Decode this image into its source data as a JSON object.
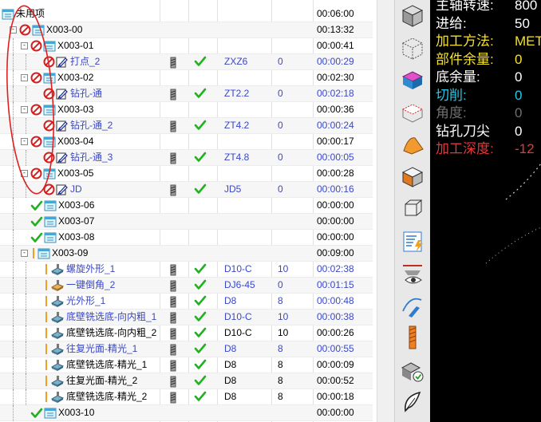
{
  "tree": {
    "rows": [
      {
        "label": "未用项",
        "time": "00:06:00",
        "type": "folder",
        "indent": 0,
        "expander": "",
        "status": "none",
        "blue": false
      },
      {
        "label": "X003-00",
        "time": "00:13:32",
        "type": "folder",
        "indent": 1,
        "expander": "-",
        "status": "forbid",
        "blue": false
      },
      {
        "label": "X003-01",
        "time": "00:00:41",
        "type": "folder",
        "indent": 2,
        "expander": "-",
        "status": "forbid",
        "blue": false
      },
      {
        "label": "打点_2",
        "tool": "ZXZ6",
        "val": "0",
        "time": "00:00:29",
        "type": "op",
        "indent": 3,
        "expander": "",
        "status": "forbid",
        "blue": true,
        "check": true
      },
      {
        "label": "X003-02",
        "time": "00:02:30",
        "type": "folder",
        "indent": 2,
        "expander": "-",
        "status": "forbid",
        "blue": false
      },
      {
        "label": "钻孔-通",
        "tool": "ZT2.2",
        "val": "0",
        "time": "00:02:18",
        "type": "op",
        "indent": 3,
        "expander": "",
        "status": "forbid",
        "blue": true,
        "check": true
      },
      {
        "label": "X003-03",
        "time": "00:00:36",
        "type": "folder",
        "indent": 2,
        "expander": "-",
        "status": "forbid",
        "blue": false
      },
      {
        "label": "钻孔-通_2",
        "tool": "ZT4.2",
        "val": "0",
        "time": "00:00:24",
        "type": "op",
        "indent": 3,
        "expander": "",
        "status": "forbid",
        "blue": true,
        "check": true
      },
      {
        "label": "X003-04",
        "time": "00:00:17",
        "type": "folder",
        "indent": 2,
        "expander": "-",
        "status": "forbid",
        "blue": false
      },
      {
        "label": "钻孔-通_3",
        "tool": "ZT4.8",
        "val": "0",
        "time": "00:00:05",
        "type": "op",
        "indent": 3,
        "expander": "",
        "status": "forbid",
        "blue": true,
        "check": true
      },
      {
        "label": "X003-05",
        "time": "00:00:28",
        "type": "folder",
        "indent": 2,
        "expander": "-",
        "status": "forbid",
        "blue": false
      },
      {
        "label": "JD",
        "tool": "JD5",
        "val": "0",
        "time": "00:00:16",
        "type": "op",
        "indent": 3,
        "expander": "",
        "status": "forbid",
        "blue": true,
        "check": true
      },
      {
        "label": "X003-06",
        "time": "00:00:00",
        "type": "folder",
        "indent": 2,
        "expander": "",
        "status": "check",
        "blue": false
      },
      {
        "label": "X003-07",
        "time": "00:00:00",
        "type": "folder",
        "indent": 2,
        "expander": "",
        "status": "check",
        "blue": false
      },
      {
        "label": "X003-08",
        "time": "00:00:00",
        "type": "folder",
        "indent": 2,
        "expander": "",
        "status": "check",
        "blue": false
      },
      {
        "label": "X003-09",
        "time": "00:09:00",
        "type": "folder",
        "indent": 2,
        "expander": "-",
        "status": "orange",
        "blue": false
      },
      {
        "label": "螺旋外形_1",
        "tool": "D10-C",
        "val": "10",
        "time": "00:02:38",
        "type": "mill",
        "indent": 3,
        "expander": "",
        "status": "orange",
        "blue": true,
        "check": true
      },
      {
        "label": "一键倒角_2",
        "tool": "DJ6-45",
        "val": "0",
        "time": "00:01:15",
        "type": "chamfer",
        "indent": 3,
        "expander": "",
        "status": "orange",
        "blue": true,
        "check": true
      },
      {
        "label": "光外形_1",
        "tool": "D8",
        "val": "8",
        "time": "00:00:48",
        "type": "mill",
        "indent": 3,
        "expander": "",
        "status": "orange",
        "blue": true,
        "check": true
      },
      {
        "label": "底壁铣选底-向内粗_1",
        "tool": "D10-C",
        "val": "10",
        "time": "00:00:38",
        "type": "mill",
        "indent": 3,
        "expander": "",
        "status": "orange",
        "blue": true,
        "check": true
      },
      {
        "label": "底壁铣选底-向内粗_2",
        "tool": "D10-C",
        "val": "10",
        "time": "00:00:26",
        "type": "mill",
        "indent": 3,
        "expander": "",
        "status": "orange",
        "blue": false,
        "check": true
      },
      {
        "label": "往复光面-精光_1",
        "tool": "D8",
        "val": "8",
        "time": "00:00:55",
        "type": "mill",
        "indent": 3,
        "expander": "",
        "status": "orange",
        "blue": true,
        "check": true
      },
      {
        "label": "底壁铣选底-精光_1",
        "tool": "D8",
        "val": "8",
        "time": "00:00:09",
        "type": "mill",
        "indent": 3,
        "expander": "",
        "status": "orange",
        "blue": false,
        "check": true
      },
      {
        "label": "往复光面-精光_2",
        "tool": "D8",
        "val": "8",
        "time": "00:00:52",
        "type": "mill",
        "indent": 3,
        "expander": "",
        "status": "orange",
        "blue": false,
        "check": true
      },
      {
        "label": "底壁铣选底-精光_2",
        "tool": "D8",
        "val": "8",
        "time": "00:00:18",
        "type": "mill",
        "indent": 3,
        "expander": "",
        "status": "orange",
        "blue": false,
        "check": true
      },
      {
        "label": "X003-10",
        "time": "00:00:00",
        "type": "folder",
        "indent": 2,
        "expander": "",
        "status": "check",
        "blue": false
      }
    ]
  },
  "toolbar": {
    "icons": [
      "solid-view-icon",
      "wireframe-view-icon",
      "blank-part-icon",
      "cut-region-icon",
      "surface-shade-icon",
      "solid-body-icon",
      "cube-axis-icon",
      "settings-list-icon",
      "eye-visibility-icon",
      "toolpath-wrench-icon",
      "drill-tool-icon",
      "verify-part-icon",
      "feather-icon"
    ]
  },
  "info": {
    "rows": [
      {
        "label": "主轴转速:",
        "value": "800",
        "color": "#ffffff"
      },
      {
        "label": "进给:",
        "value": "50",
        "color": "#ffffff"
      },
      {
        "label": "加工方法:",
        "value": "MET",
        "color": "#f5e02a"
      },
      {
        "label": "部件余量:",
        "value": "0",
        "color": "#f5e02a"
      },
      {
        "label": "底余量:",
        "value": "0",
        "color": "#ffffff"
      },
      {
        "label": "切削:",
        "value": "0",
        "color": "#26c8e8"
      },
      {
        "label": "角度:",
        "value": "0",
        "color": "#6f6f6f"
      },
      {
        "label": "钻孔刀尖",
        "value": "0",
        "color": "#ffffff"
      },
      {
        "label": "加工深度:",
        "value": "-12",
        "color": "#e23a3a"
      }
    ]
  },
  "colors": {
    "accent": "#3a48c8",
    "check": "#22b022",
    "forbid": "#d81e1e",
    "orange": "#f0a020",
    "annotation": "#e02020"
  }
}
